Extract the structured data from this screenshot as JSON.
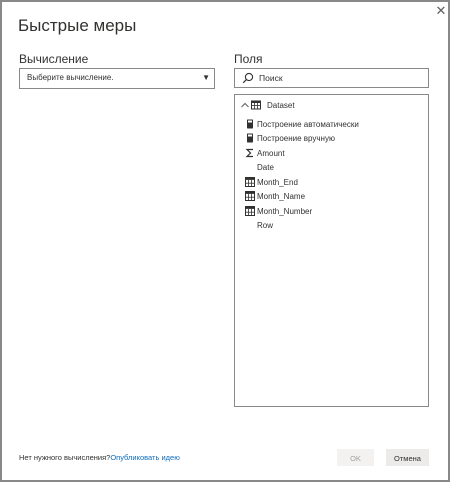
{
  "dialog": {
    "title": "Быстрые меры",
    "close_glyph": "✕"
  },
  "calculation": {
    "label": "Вычисление",
    "select_value": "Выберите вычисление.",
    "arrow_glyph": "▼"
  },
  "fields": {
    "label": "Поля",
    "search_placeholder": "Поиск",
    "dataset": {
      "name": "Dataset",
      "expanded": true
    },
    "items": [
      {
        "label": "Построение автоматически",
        "icon": "calculator-icon"
      },
      {
        "label": "Построение вручную",
        "icon": "calculator-icon"
      },
      {
        "label": "Amount",
        "icon": "sigma-icon"
      },
      {
        "label": "Date",
        "icon": "none"
      },
      {
        "label": "Month_End",
        "icon": "date-table-icon"
      },
      {
        "label": "Month_Name",
        "icon": "date-table-icon"
      },
      {
        "label": "Month_Number",
        "icon": "date-table-icon"
      },
      {
        "label": "Row",
        "icon": "none"
      }
    ]
  },
  "footer": {
    "question": "Нет нужного вычисления?",
    "link": "Опубликовать идею"
  },
  "buttons": {
    "ok": "OK",
    "cancel": "Отмена"
  },
  "colors": {
    "border": "#8a8886",
    "link": "#0f6cbd",
    "disabled_text": "#a19f9d"
  }
}
